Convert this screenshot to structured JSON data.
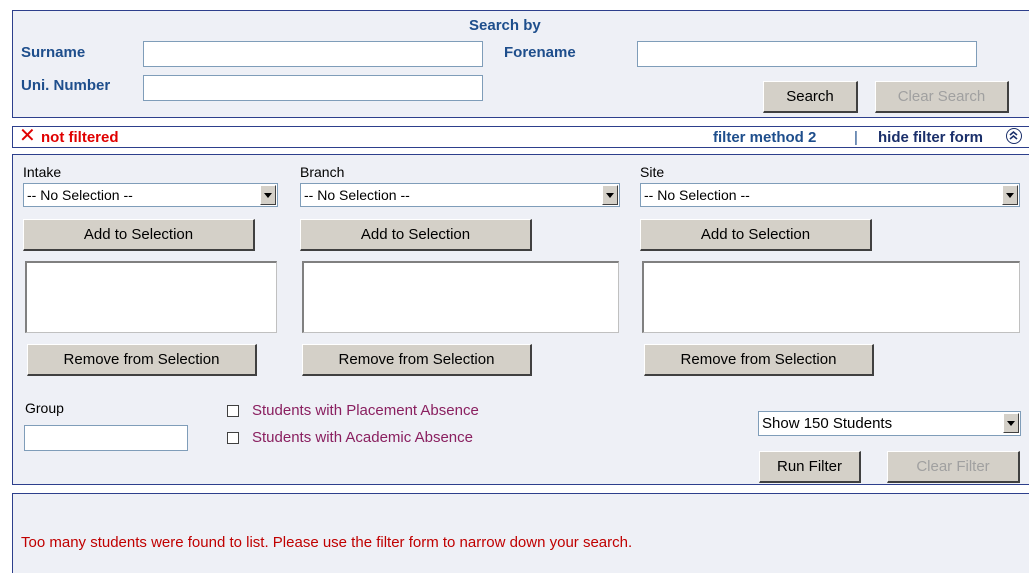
{
  "search": {
    "heading": "Search by",
    "surname_label": "Surname",
    "forename_label": "Forename",
    "uni_number_label": "Uni. Number",
    "surname_value": "",
    "forename_value": "",
    "uni_number_value": "",
    "search_button": "Search",
    "clear_search_button": "Clear Search"
  },
  "filter_bar": {
    "status_text": "not filtered",
    "method_text": "filter method 2",
    "separator": "|",
    "hide_text": "hide filter form",
    "status_color": "#e00000"
  },
  "filter": {
    "intake": {
      "label": "Intake",
      "selected": "-- No Selection --",
      "add_button": "Add to Selection",
      "remove_button": "Remove from Selection"
    },
    "branch": {
      "label": "Branch",
      "selected": "-- No Selection --",
      "add_button": "Add to Selection",
      "remove_button": "Remove from Selection"
    },
    "site": {
      "label": "Site",
      "selected": "-- No Selection --",
      "add_button": "Add to Selection",
      "remove_button": "Remove from Selection"
    },
    "group_label": "Group",
    "group_value": "",
    "placement_absence_label": "Students with Placement Absence",
    "academic_absence_label": "Students with Academic Absence",
    "show_count_selected": "Show 150 Students",
    "run_filter_button": "Run Filter",
    "clear_filter_button": "Clear Filter"
  },
  "message": {
    "text": "Too many students were found to list. Please use the filter form to narrow down your search.",
    "color": "#c00000"
  }
}
